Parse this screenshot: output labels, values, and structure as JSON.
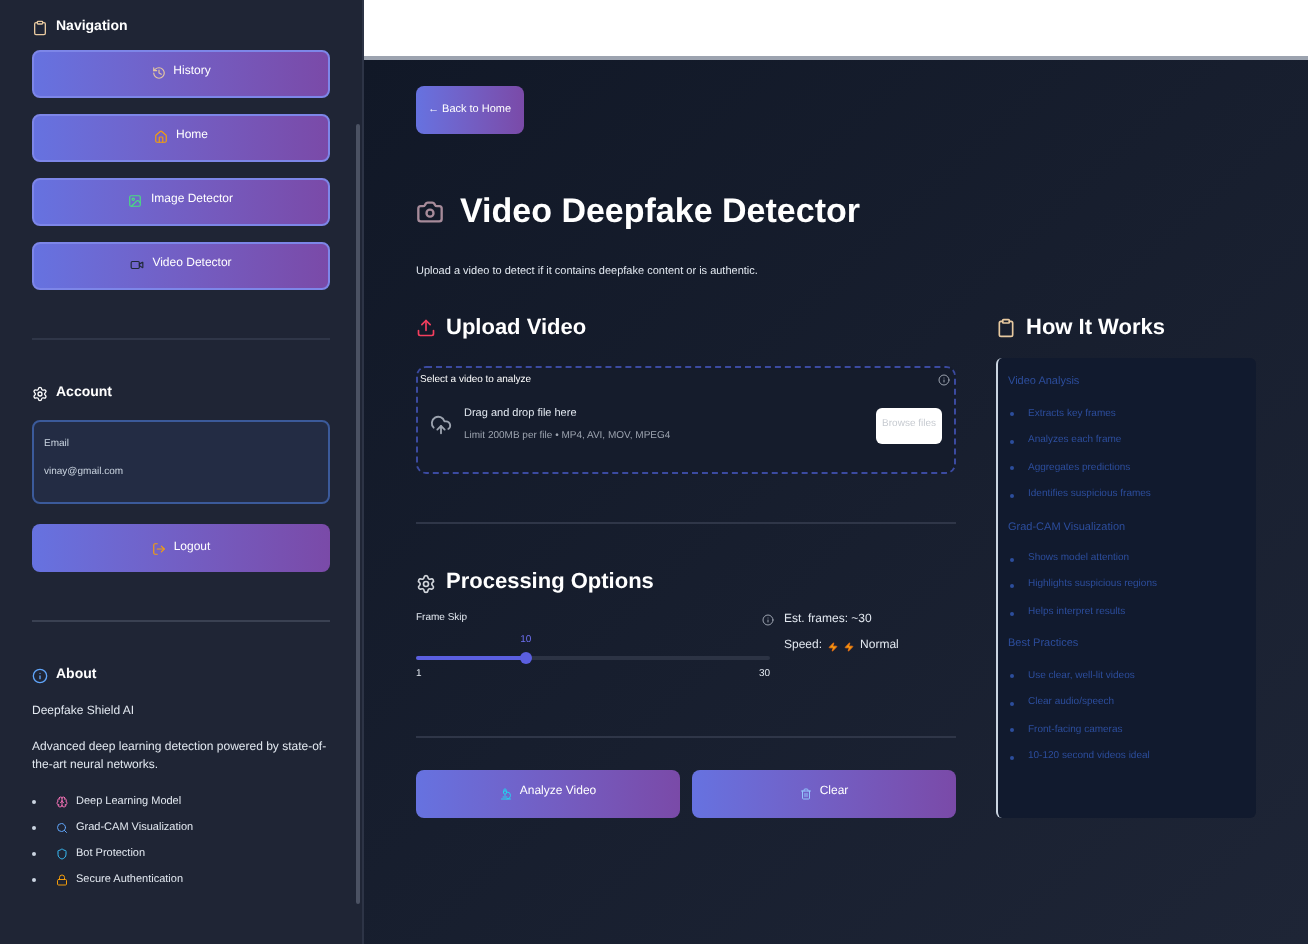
{
  "sidebar": {
    "navigation": {
      "title": "Navigation",
      "buttons": [
        {
          "label": "History",
          "kind": "history"
        },
        {
          "label": "Home",
          "kind": "home"
        },
        {
          "label": "Image Detector",
          "kind": "image"
        },
        {
          "label": "Video Detector",
          "kind": "video"
        }
      ]
    },
    "account": {
      "title": "Account",
      "email_label": "Email",
      "email": "vinay@gmail.com",
      "logout": "Logout"
    },
    "about": {
      "title": "About",
      "name": "Deepfake Shield AI",
      "description": "Advanced deep learning detection powered by state-of-the-art neural networks.",
      "features": [
        {
          "label": "Deep Learning Model",
          "kind": "brain"
        },
        {
          "label": "Grad-CAM Visualization",
          "kind": "search"
        },
        {
          "label": "Bot Protection",
          "kind": "shield"
        },
        {
          "label": "Secure Authentication",
          "kind": "lock"
        }
      ]
    }
  },
  "main": {
    "back_button": "← Back to Home",
    "title": "Video Deepfake Detector",
    "subtitle": "Upload a video to detect if it contains deepfake content or is authentic.",
    "upload": {
      "title": "Upload Video",
      "label": "Select a video to analyze",
      "drop_text": "Drag and drop file here",
      "limit_text": "Limit 200MB per file • MP4, AVI, MOV, MPEG4",
      "browse_button": "Browse files"
    },
    "processing": {
      "title": "Processing Options",
      "slider": {
        "label": "Frame Skip",
        "value": "10",
        "min": "1",
        "max": "30",
        "level": 0.31
      },
      "est_frames": "Est. frames: ~30",
      "speed_label": "Speed:",
      "speed_value": "Normal"
    },
    "actions": [
      {
        "label": "Analyze Video",
        "kind": "analyze"
      },
      {
        "label": "Clear",
        "kind": "clear"
      }
    ],
    "how_it_works": {
      "title": "How It Works",
      "sections": [
        {
          "heading": "Video Analysis",
          "items": [
            "Extracts key frames",
            "Analyzes each frame",
            "Aggregates predictions",
            "Identifies suspicious frames"
          ]
        },
        {
          "heading": "Grad-CAM Visualization",
          "items": [
            "Shows model attention",
            "Highlights suspicious regions",
            "Helps interpret results"
          ]
        },
        {
          "heading": "Best Practices",
          "items": [
            "Use clear, well-lit videos",
            "Clear audio/speech",
            "Front-facing cameras",
            "10-120 second videos ideal"
          ]
        }
      ]
    }
  }
}
